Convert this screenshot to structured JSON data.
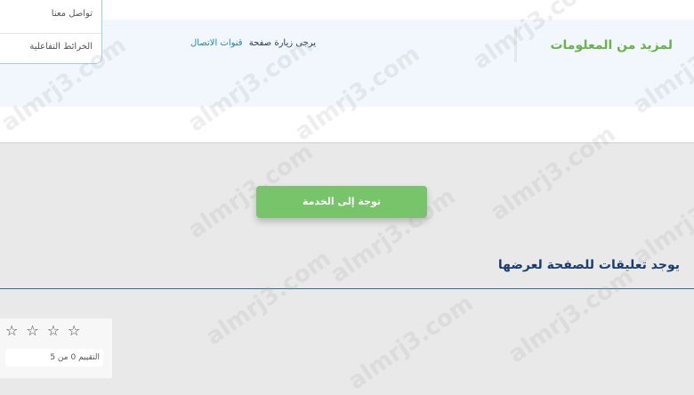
{
  "dropdown": {
    "items": [
      "تواصل معنا",
      "الخرائط التفاعلية"
    ]
  },
  "info": {
    "title": "لمزيد من المعلومات",
    "visit_text": "يرجى زيارة صفحة",
    "channels_link": "قنوات الاتصال"
  },
  "service_button": {
    "label": "توجة إلى الخدمة"
  },
  "comments": {
    "title": "يوجد تعليقات للصفحة لعرضها"
  },
  "rating": {
    "stars": 4,
    "selected": 0,
    "caption": "التقييم 0 من 5"
  },
  "watermark": {
    "text": "almrj3.com"
  },
  "colors": {
    "accent_green": "#78c46a",
    "title_green": "#6ab24a",
    "link_blue": "#1f86b8",
    "heading_navy": "#1a3d6e"
  }
}
